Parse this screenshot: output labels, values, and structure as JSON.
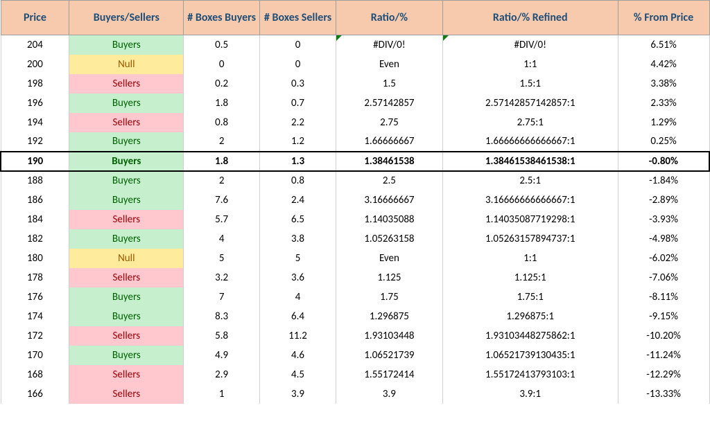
{
  "headers": {
    "price": "Price",
    "bs": "Buyers/Sellers",
    "boxes_buyers": "# Boxes Buyers",
    "boxes_sellers": "# Boxes Sellers",
    "ratio": "Ratio/%",
    "ratio_refined": "Ratio/% Refined",
    "pct_from_price": "% From Price"
  },
  "bs_labels": {
    "Buyers": "Buyers",
    "Sellers": "Sellers",
    "Null": "Null"
  },
  "rows": [
    {
      "price": "204",
      "bs": "Buyers",
      "boxes_buyers": "0.5",
      "boxes_sellers": "0",
      "ratio": "#DIV/0!",
      "ratio_refined": "#DIV/0!",
      "pct": "6.51%",
      "err": true,
      "hl": false
    },
    {
      "price": "200",
      "bs": "Null",
      "boxes_buyers": "0",
      "boxes_sellers": "0",
      "ratio": "Even",
      "ratio_refined": "1:1",
      "pct": "4.42%",
      "err": false,
      "hl": false
    },
    {
      "price": "198",
      "bs": "Sellers",
      "boxes_buyers": "0.2",
      "boxes_sellers": "0.3",
      "ratio": "1.5",
      "ratio_refined": "1.5:1",
      "pct": "3.38%",
      "err": false,
      "hl": false
    },
    {
      "price": "196",
      "bs": "Buyers",
      "boxes_buyers": "1.8",
      "boxes_sellers": "0.7",
      "ratio": "2.57142857",
      "ratio_refined": "2.57142857142857:1",
      "pct": "2.33%",
      "err": false,
      "hl": false
    },
    {
      "price": "194",
      "bs": "Sellers",
      "boxes_buyers": "0.8",
      "boxes_sellers": "2.2",
      "ratio": "2.75",
      "ratio_refined": "2.75:1",
      "pct": "1.29%",
      "err": false,
      "hl": false
    },
    {
      "price": "192",
      "bs": "Buyers",
      "boxes_buyers": "2",
      "boxes_sellers": "1.2",
      "ratio": "1.66666667",
      "ratio_refined": "1.66666666666667:1",
      "pct": "0.25%",
      "err": false,
      "hl": false
    },
    {
      "price": "190",
      "bs": "Buyers",
      "boxes_buyers": "1.8",
      "boxes_sellers": "1.3",
      "ratio": "1.38461538",
      "ratio_refined": "1.38461538461538:1",
      "pct": "-0.80%",
      "err": false,
      "hl": true
    },
    {
      "price": "188",
      "bs": "Buyers",
      "boxes_buyers": "2",
      "boxes_sellers": "0.8",
      "ratio": "2.5",
      "ratio_refined": "2.5:1",
      "pct": "-1.84%",
      "err": false,
      "hl": false
    },
    {
      "price": "186",
      "bs": "Buyers",
      "boxes_buyers": "7.6",
      "boxes_sellers": "2.4",
      "ratio": "3.16666667",
      "ratio_refined": "3.16666666666667:1",
      "pct": "-2.89%",
      "err": false,
      "hl": false
    },
    {
      "price": "184",
      "bs": "Sellers",
      "boxes_buyers": "5.7",
      "boxes_sellers": "6.5",
      "ratio": "1.14035088",
      "ratio_refined": "1.14035087719298:1",
      "pct": "-3.93%",
      "err": false,
      "hl": false
    },
    {
      "price": "182",
      "bs": "Buyers",
      "boxes_buyers": "4",
      "boxes_sellers": "3.8",
      "ratio": "1.05263158",
      "ratio_refined": "1.05263157894737:1",
      "pct": "-4.98%",
      "err": false,
      "hl": false
    },
    {
      "price": "180",
      "bs": "Null",
      "boxes_buyers": "5",
      "boxes_sellers": "5",
      "ratio": "Even",
      "ratio_refined": "1:1",
      "pct": "-6.02%",
      "err": false,
      "hl": false
    },
    {
      "price": "178",
      "bs": "Sellers",
      "boxes_buyers": "3.2",
      "boxes_sellers": "3.6",
      "ratio": "1.125",
      "ratio_refined": "1.125:1",
      "pct": "-7.06%",
      "err": false,
      "hl": false
    },
    {
      "price": "176",
      "bs": "Buyers",
      "boxes_buyers": "7",
      "boxes_sellers": "4",
      "ratio": "1.75",
      "ratio_refined": "1.75:1",
      "pct": "-8.11%",
      "err": false,
      "hl": false
    },
    {
      "price": "174",
      "bs": "Buyers",
      "boxes_buyers": "8.3",
      "boxes_sellers": "6.4",
      "ratio": "1.296875",
      "ratio_refined": "1.296875:1",
      "pct": "-9.15%",
      "err": false,
      "hl": false
    },
    {
      "price": "172",
      "bs": "Sellers",
      "boxes_buyers": "5.8",
      "boxes_sellers": "11.2",
      "ratio": "1.93103448",
      "ratio_refined": "1.93103448275862:1",
      "pct": "-10.20%",
      "err": false,
      "hl": false
    },
    {
      "price": "170",
      "bs": "Buyers",
      "boxes_buyers": "4.9",
      "boxes_sellers": "4.6",
      "ratio": "1.06521739",
      "ratio_refined": "1.06521739130435:1",
      "pct": "-11.24%",
      "err": false,
      "hl": false
    },
    {
      "price": "168",
      "bs": "Sellers",
      "boxes_buyers": "2.9",
      "boxes_sellers": "4.5",
      "ratio": "1.55172414",
      "ratio_refined": "1.55172413793103:1",
      "pct": "-12.29%",
      "err": false,
      "hl": false
    },
    {
      "price": "166",
      "bs": "Sellers",
      "boxes_buyers": "1",
      "boxes_sellers": "3.9",
      "ratio": "3.9",
      "ratio_refined": "3.9:1",
      "pct": "-13.33%",
      "err": false,
      "hl": false
    }
  ]
}
